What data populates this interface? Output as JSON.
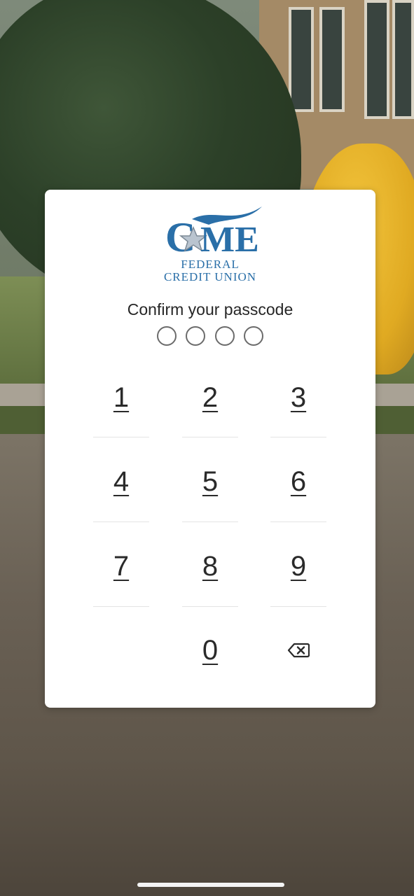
{
  "logo": {
    "mark_text": "CME",
    "line1": "FEDERAL",
    "line2": "CREDIT UNION"
  },
  "prompt": "Confirm your passcode",
  "passcode_length": 4,
  "passcode_entered": 0,
  "keypad": {
    "keys": [
      "1",
      "2",
      "3",
      "4",
      "5",
      "6",
      "7",
      "8",
      "9",
      "0"
    ],
    "backspace_icon": "backspace-icon"
  },
  "colors": {
    "brand_blue": "#2a6fa8",
    "card_bg": "#ffffff",
    "text": "#262626"
  }
}
